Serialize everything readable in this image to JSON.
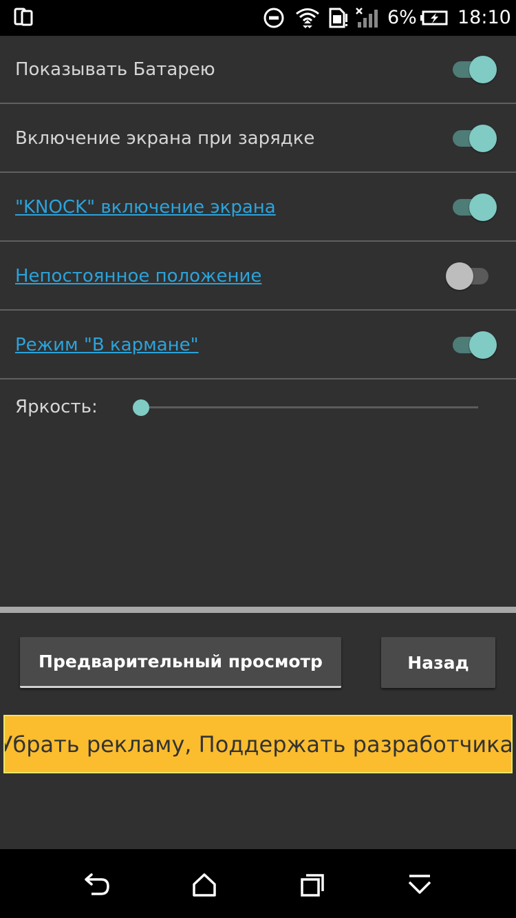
{
  "status_bar": {
    "battery_percent": "6%",
    "time": "18:10",
    "icons": [
      "recents-app-icon",
      "do-not-disturb-icon",
      "wifi-icon",
      "sim-card-icon",
      "signal-icon",
      "battery-charging-icon"
    ]
  },
  "settings": {
    "rows": [
      {
        "label": "Показывать Батарею",
        "enabled": true,
        "link": false
      },
      {
        "label": "Включение экрана при зарядке",
        "enabled": true,
        "link": false
      },
      {
        "label": "\"KNOCK\" включение экрана",
        "enabled": true,
        "link": true
      },
      {
        "label": "Непостоянное положение",
        "enabled": false,
        "link": true
      },
      {
        "label": "Режим \"В кармане\"",
        "enabled": true,
        "link": true
      }
    ],
    "brightness": {
      "label": "Яркость:",
      "value_fraction": 0.0
    }
  },
  "buttons": {
    "preview_label": "Предварительный просмотр",
    "back_label": "Назад"
  },
  "banner": {
    "text": "Убрать рекламу, Поддержать разработчика"
  },
  "nav_bar": {
    "icons": [
      "back-icon",
      "home-icon",
      "recents-icon",
      "hide-nav-icon"
    ]
  },
  "colors": {
    "accent": "#80cbc4",
    "link": "#2ba3db",
    "banner": "#fbbd2e",
    "background": "#303030"
  }
}
